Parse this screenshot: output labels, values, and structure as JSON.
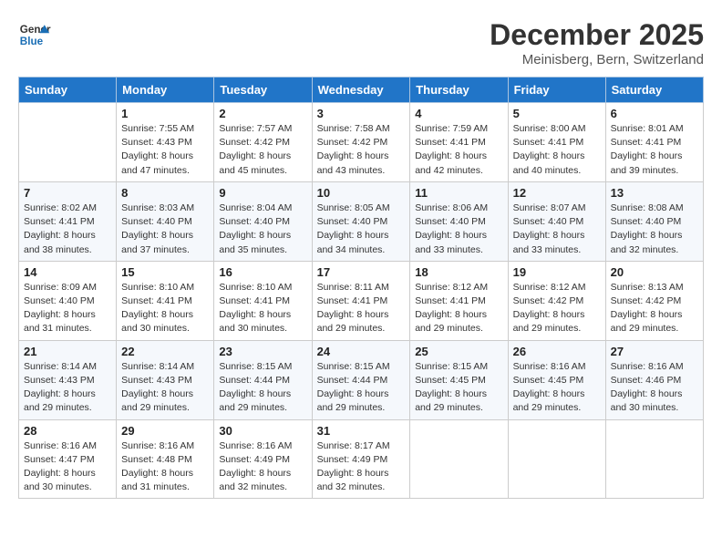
{
  "logo": {
    "line1": "General",
    "line2": "Blue"
  },
  "title": "December 2025",
  "subtitle": "Meinisberg, Bern, Switzerland",
  "header": {
    "accent_color": "#2175c8"
  },
  "days_of_week": [
    "Sunday",
    "Monday",
    "Tuesday",
    "Wednesday",
    "Thursday",
    "Friday",
    "Saturday"
  ],
  "weeks": [
    [
      {
        "day": "",
        "sunrise": "",
        "sunset": "",
        "daylight": ""
      },
      {
        "day": "1",
        "sunrise": "Sunrise: 7:55 AM",
        "sunset": "Sunset: 4:43 PM",
        "daylight": "Daylight: 8 hours and 47 minutes."
      },
      {
        "day": "2",
        "sunrise": "Sunrise: 7:57 AM",
        "sunset": "Sunset: 4:42 PM",
        "daylight": "Daylight: 8 hours and 45 minutes."
      },
      {
        "day": "3",
        "sunrise": "Sunrise: 7:58 AM",
        "sunset": "Sunset: 4:42 PM",
        "daylight": "Daylight: 8 hours and 43 minutes."
      },
      {
        "day": "4",
        "sunrise": "Sunrise: 7:59 AM",
        "sunset": "Sunset: 4:41 PM",
        "daylight": "Daylight: 8 hours and 42 minutes."
      },
      {
        "day": "5",
        "sunrise": "Sunrise: 8:00 AM",
        "sunset": "Sunset: 4:41 PM",
        "daylight": "Daylight: 8 hours and 40 minutes."
      },
      {
        "day": "6",
        "sunrise": "Sunrise: 8:01 AM",
        "sunset": "Sunset: 4:41 PM",
        "daylight": "Daylight: 8 hours and 39 minutes."
      }
    ],
    [
      {
        "day": "7",
        "sunrise": "Sunrise: 8:02 AM",
        "sunset": "Sunset: 4:41 PM",
        "daylight": "Daylight: 8 hours and 38 minutes."
      },
      {
        "day": "8",
        "sunrise": "Sunrise: 8:03 AM",
        "sunset": "Sunset: 4:40 PM",
        "daylight": "Daylight: 8 hours and 37 minutes."
      },
      {
        "day": "9",
        "sunrise": "Sunrise: 8:04 AM",
        "sunset": "Sunset: 4:40 PM",
        "daylight": "Daylight: 8 hours and 35 minutes."
      },
      {
        "day": "10",
        "sunrise": "Sunrise: 8:05 AM",
        "sunset": "Sunset: 4:40 PM",
        "daylight": "Daylight: 8 hours and 34 minutes."
      },
      {
        "day": "11",
        "sunrise": "Sunrise: 8:06 AM",
        "sunset": "Sunset: 4:40 PM",
        "daylight": "Daylight: 8 hours and 33 minutes."
      },
      {
        "day": "12",
        "sunrise": "Sunrise: 8:07 AM",
        "sunset": "Sunset: 4:40 PM",
        "daylight": "Daylight: 8 hours and 33 minutes."
      },
      {
        "day": "13",
        "sunrise": "Sunrise: 8:08 AM",
        "sunset": "Sunset: 4:40 PM",
        "daylight": "Daylight: 8 hours and 32 minutes."
      }
    ],
    [
      {
        "day": "14",
        "sunrise": "Sunrise: 8:09 AM",
        "sunset": "Sunset: 4:40 PM",
        "daylight": "Daylight: 8 hours and 31 minutes."
      },
      {
        "day": "15",
        "sunrise": "Sunrise: 8:10 AM",
        "sunset": "Sunset: 4:41 PM",
        "daylight": "Daylight: 8 hours and 30 minutes."
      },
      {
        "day": "16",
        "sunrise": "Sunrise: 8:10 AM",
        "sunset": "Sunset: 4:41 PM",
        "daylight": "Daylight: 8 hours and 30 minutes."
      },
      {
        "day": "17",
        "sunrise": "Sunrise: 8:11 AM",
        "sunset": "Sunset: 4:41 PM",
        "daylight": "Daylight: 8 hours and 29 minutes."
      },
      {
        "day": "18",
        "sunrise": "Sunrise: 8:12 AM",
        "sunset": "Sunset: 4:41 PM",
        "daylight": "Daylight: 8 hours and 29 minutes."
      },
      {
        "day": "19",
        "sunrise": "Sunrise: 8:12 AM",
        "sunset": "Sunset: 4:42 PM",
        "daylight": "Daylight: 8 hours and 29 minutes."
      },
      {
        "day": "20",
        "sunrise": "Sunrise: 8:13 AM",
        "sunset": "Sunset: 4:42 PM",
        "daylight": "Daylight: 8 hours and 29 minutes."
      }
    ],
    [
      {
        "day": "21",
        "sunrise": "Sunrise: 8:14 AM",
        "sunset": "Sunset: 4:43 PM",
        "daylight": "Daylight: 8 hours and 29 minutes."
      },
      {
        "day": "22",
        "sunrise": "Sunrise: 8:14 AM",
        "sunset": "Sunset: 4:43 PM",
        "daylight": "Daylight: 8 hours and 29 minutes."
      },
      {
        "day": "23",
        "sunrise": "Sunrise: 8:15 AM",
        "sunset": "Sunset: 4:44 PM",
        "daylight": "Daylight: 8 hours and 29 minutes."
      },
      {
        "day": "24",
        "sunrise": "Sunrise: 8:15 AM",
        "sunset": "Sunset: 4:44 PM",
        "daylight": "Daylight: 8 hours and 29 minutes."
      },
      {
        "day": "25",
        "sunrise": "Sunrise: 8:15 AM",
        "sunset": "Sunset: 4:45 PM",
        "daylight": "Daylight: 8 hours and 29 minutes."
      },
      {
        "day": "26",
        "sunrise": "Sunrise: 8:16 AM",
        "sunset": "Sunset: 4:45 PM",
        "daylight": "Daylight: 8 hours and 29 minutes."
      },
      {
        "day": "27",
        "sunrise": "Sunrise: 8:16 AM",
        "sunset": "Sunset: 4:46 PM",
        "daylight": "Daylight: 8 hours and 30 minutes."
      }
    ],
    [
      {
        "day": "28",
        "sunrise": "Sunrise: 8:16 AM",
        "sunset": "Sunset: 4:47 PM",
        "daylight": "Daylight: 8 hours and 30 minutes."
      },
      {
        "day": "29",
        "sunrise": "Sunrise: 8:16 AM",
        "sunset": "Sunset: 4:48 PM",
        "daylight": "Daylight: 8 hours and 31 minutes."
      },
      {
        "day": "30",
        "sunrise": "Sunrise: 8:16 AM",
        "sunset": "Sunset: 4:49 PM",
        "daylight": "Daylight: 8 hours and 32 minutes."
      },
      {
        "day": "31",
        "sunrise": "Sunrise: 8:17 AM",
        "sunset": "Sunset: 4:49 PM",
        "daylight": "Daylight: 8 hours and 32 minutes."
      },
      {
        "day": "",
        "sunrise": "",
        "sunset": "",
        "daylight": ""
      },
      {
        "day": "",
        "sunrise": "",
        "sunset": "",
        "daylight": ""
      },
      {
        "day": "",
        "sunrise": "",
        "sunset": "",
        "daylight": ""
      }
    ]
  ]
}
